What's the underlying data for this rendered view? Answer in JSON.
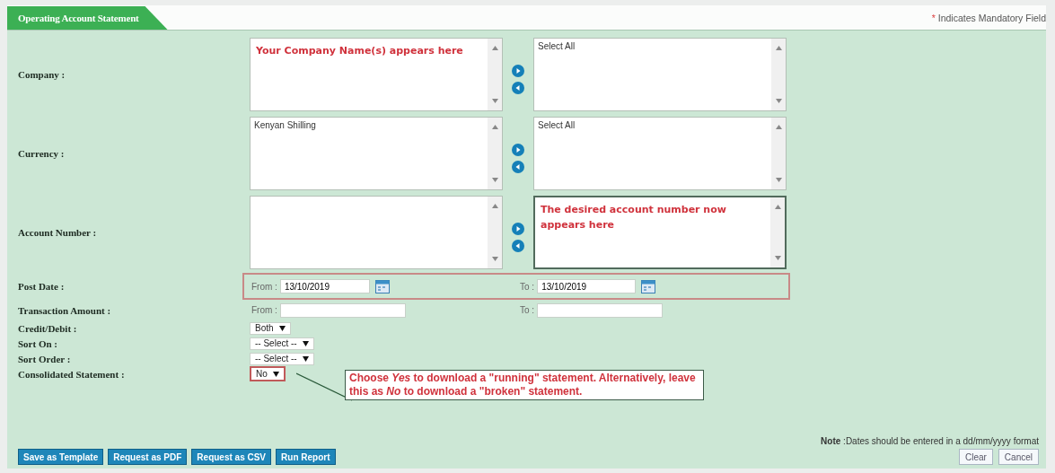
{
  "tab": {
    "title": "Operating Account Statement"
  },
  "mandatory_note": {
    "asterisk": "*",
    "text": "Indicates Mandatory Field"
  },
  "fields": [
    {
      "kind": "picker",
      "label": "Company :",
      "available": [
        {
          "text": "Your Company Name(s) appears here",
          "annotation": true
        }
      ],
      "chosen": [
        {
          "text": "Select All",
          "annotation": false
        }
      ],
      "chosen_highlighted": false
    },
    {
      "kind": "picker",
      "label": "Currency :",
      "available": [
        {
          "text": "Kenyan Shilling",
          "annotation": false
        }
      ],
      "chosen": [
        {
          "text": "Select All",
          "annotation": false
        }
      ],
      "chosen_highlighted": false
    },
    {
      "kind": "picker",
      "label": "Account Number :",
      "chosen": [
        {
          "text": "The desired account number now appears here",
          "annotation": true
        }
      ],
      "chosen_highlighted": true
    },
    {
      "kind": "range",
      "label": "Post Date :",
      "from_label": "From :",
      "from_value": "13/10/2019",
      "to_label": "To :",
      "to_value": "13/10/2019",
      "calendar": true,
      "highlighted": true
    },
    {
      "kind": "range",
      "label": "Transaction Amount :",
      "from_label": "From :",
      "to_label": "To :",
      "calendar": false,
      "highlighted": false
    },
    {
      "kind": "select",
      "label": "Credit/Debit :",
      "value": "Both",
      "highlighted": false
    },
    {
      "kind": "select",
      "label": "Sort On :",
      "value": "-- Select -- ",
      "highlighted": false
    },
    {
      "kind": "select",
      "label": "Sort Order :",
      "value": "-- Select --",
      "highlighted": false
    },
    {
      "kind": "select",
      "label": "Consolidated Statement :",
      "value": "No",
      "highlighted": true,
      "callout": "Choose *Yes* to download a \"running\" statement. Alternatively, leave this as *No* to download a \"broken\" statement."
    }
  ],
  "note": "**Note** :Dates should be entered in a dd/mm/yyyy format",
  "buttons": [
    {
      "label": "Save as Template",
      "kind": "primary"
    },
    {
      "label": "Request as PDF",
      "kind": "primary"
    },
    {
      "label": "Request as CSV",
      "kind": "primary"
    },
    {
      "label": "Run Report",
      "kind": "primary"
    },
    {
      "label": "Clear",
      "kind": "secondary"
    },
    {
      "label": "Cancel",
      "kind": "secondary"
    }
  ]
}
